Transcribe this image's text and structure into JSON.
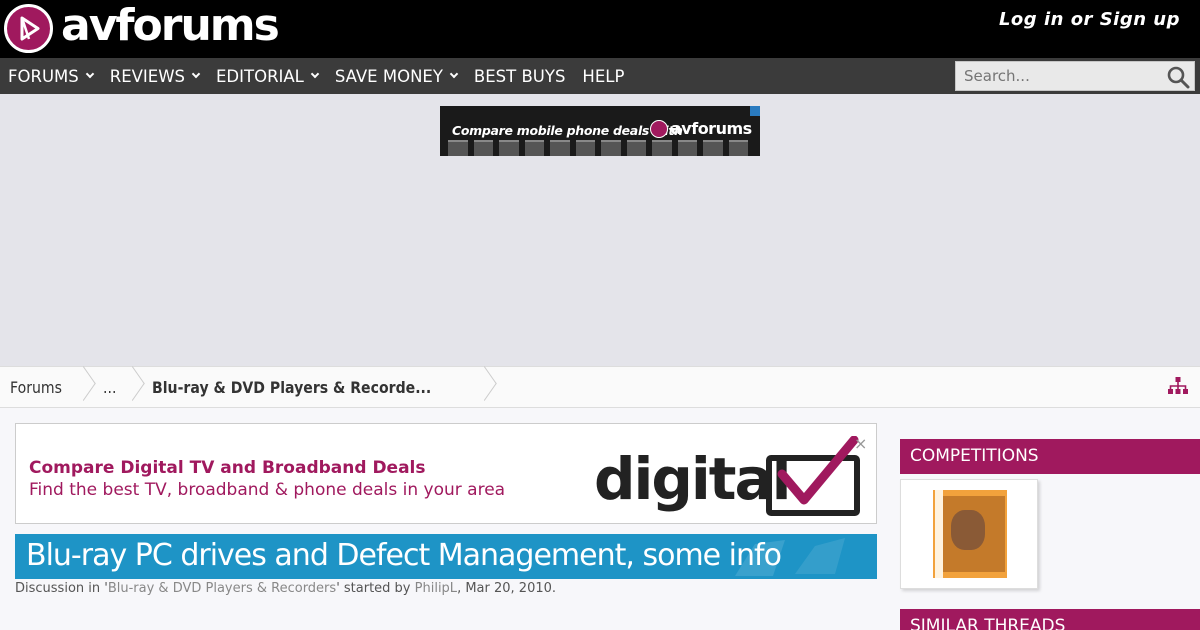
{
  "header": {
    "logo_text": "avforums",
    "login_label": "Log in or Sign up"
  },
  "nav": {
    "items": [
      {
        "label": "FORUMS",
        "dropdown": true
      },
      {
        "label": "REVIEWS",
        "dropdown": true
      },
      {
        "label": "EDITORIAL",
        "dropdown": true
      },
      {
        "label": "SAVE MONEY",
        "dropdown": true
      },
      {
        "label": "BEST BUYS",
        "dropdown": false
      },
      {
        "label": "HELP",
        "dropdown": false
      }
    ],
    "search_placeholder": "Search..."
  },
  "ad_top": {
    "text": "Compare mobile phone deals with",
    "brand": "avforums"
  },
  "breadcrumb": {
    "items": [
      "Forums",
      "...",
      "Blu-ray & DVD Players & Recorde..."
    ]
  },
  "promo": {
    "title": "Compare Digital TV and Broadband Deals",
    "subtitle": "Find the best TV, broadband & phone deals in your area",
    "logo_word": "digital",
    "close": "×"
  },
  "thread": {
    "title": "Blu-ray PC drives and Defect Management, some info",
    "meta_prefix": "Discussion in '",
    "forum_link": "Blu-ray & DVD Players & Recorders",
    "meta_mid": "' started by ",
    "author": "PhilipL",
    "date": ", Mar 20, 2010."
  },
  "sidebar": {
    "competitions": "COMPETITIONS",
    "similar_threads": "SIMILAR THREADS"
  },
  "colors": {
    "brand": "#a0195e",
    "title_bar": "#1e94c6",
    "nav_bg": "#3b3b3b"
  }
}
